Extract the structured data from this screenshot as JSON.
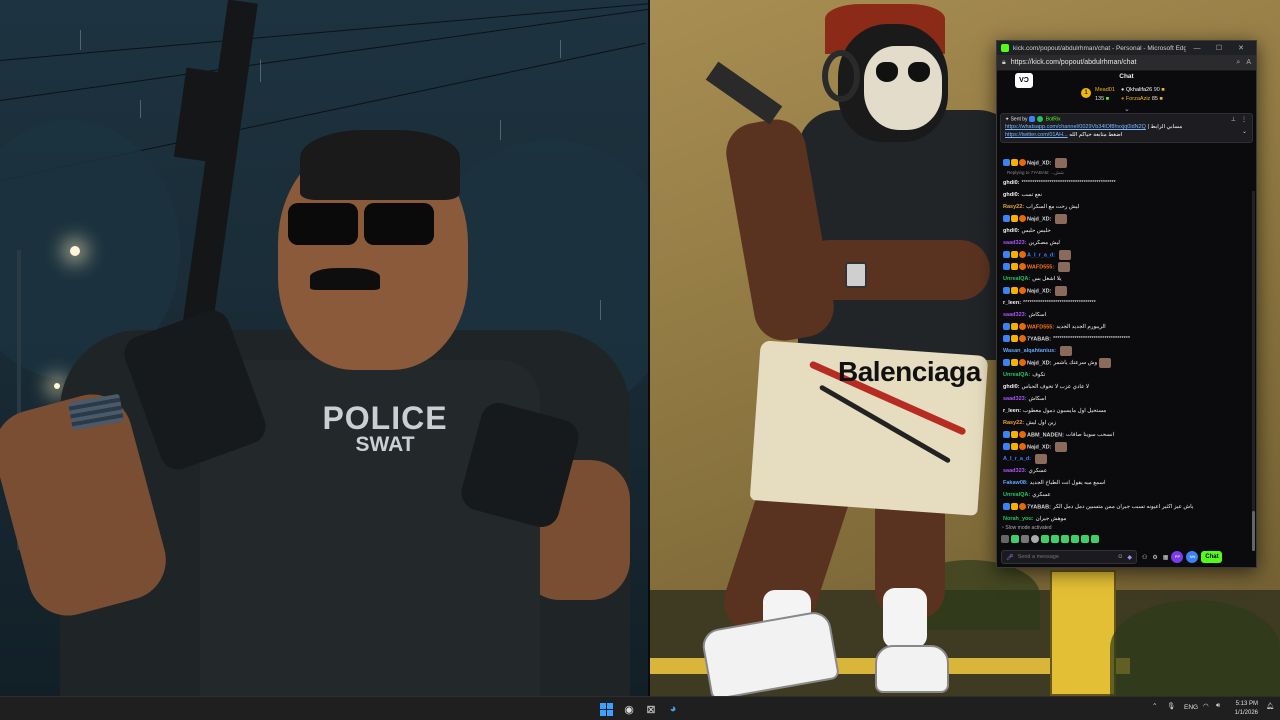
{
  "left_panel": {
    "vest_line1": "POLICE",
    "vest_line2": "SWAT"
  },
  "right_panel": {
    "shorts_text": "Balenciaga"
  },
  "browser": {
    "title": "kick.com/popout/abdulrhman/chat - Personal - Microsoft Edge",
    "url": "https://kick.com/popout/abdulrhman/chat",
    "chat_title": "Chat",
    "channel_badge": "VƆ",
    "leaderboard": {
      "rank": "1",
      "first": {
        "name": "Mead01",
        "value": "135"
      },
      "second": {
        "name": "Qkhalifa26",
        "value": "90"
      },
      "third": {
        "name": "ForzaAziz",
        "value": "85"
      }
    },
    "pinned": {
      "sent_by_label": "Sent by",
      "bot_name": "BotRix",
      "text_prefix": "| مسابي الرابط",
      "link1": "https://whatsapp.com/channel/0029Vb34lOf8hvxjq0ldN2Q",
      "link2": "https://twitter.com/01AH...",
      "text_suffix": "اضغط متابعة حياكم الله"
    },
    "messages": [
      {
        "user": "Najd_XD:",
        "text": "",
        "color": "#d6d6d6",
        "badges": true,
        "emote": true
      },
      {
        "reply": "Replying to 7YABAB: ...شش"
      },
      {
        "user": "ghdi0:",
        "text": "********************************************",
        "color": "#f2f2f2"
      },
      {
        "user": "ghdi0:",
        "text": "نعع تسب",
        "color": "#f2f2f2"
      },
      {
        "user": "Rasy22:",
        "text": "ليش رحت مع السكراب",
        "color": "#e6a23c"
      },
      {
        "user": "Najd_XD:",
        "text": "",
        "color": "#d6d6d6",
        "badges": true,
        "emote": true
      },
      {
        "user": "ghdi0:",
        "text": "حلبس حلبس",
        "color": "#f2f2f2"
      },
      {
        "user": "saad323:",
        "text": "ليش مصكرين",
        "color": "#a855f7"
      },
      {
        "user": "A_I_r_a_d:",
        "text": "",
        "color": "#3b82f6",
        "badges": true,
        "emote": true
      },
      {
        "user": "WAFD555:",
        "text": "",
        "color": "#f97316",
        "badges": true,
        "emote": true
      },
      {
        "user": "UnrealQA:",
        "text": "يلا اشغل بس",
        "color": "#22c55e"
      },
      {
        "user": "Najd_XD:",
        "text": "",
        "color": "#d6d6d6",
        "badges": true,
        "emote": true
      },
      {
        "user": "r_leen:",
        "text": "**********************************",
        "color": "#f2f2f2"
      },
      {
        "user": "saad323:",
        "text": "اسكاش",
        "color": "#a855f7"
      },
      {
        "user": "WAFD555:",
        "text": "الريبورم الجديد الجديد",
        "color": "#f97316",
        "badges": true
      },
      {
        "user": "7YABAB:",
        "text": "************************************",
        "color": "#d6d6d6",
        "badges": true
      },
      {
        "user": "Wasan_alqahtanius:",
        "text": "",
        "color": "#60a5fa",
        "emote": true
      },
      {
        "user": "Najd_XD:",
        "text": "وش سرعتك ياشمر",
        "color": "#d6d6d6",
        "badges": true,
        "emote": true
      },
      {
        "user": "UnrealQA:",
        "text": "تكوف",
        "color": "#22c55e"
      },
      {
        "user": "ghdi0:",
        "text": "لا عادي عزب لا تخوف الحباس",
        "color": "#f2f2f2"
      },
      {
        "user": "saad323:",
        "text": "اسكاش",
        "color": "#a855f7"
      },
      {
        "user": "r_leen:",
        "text": "مستحيل اول مايسبون دمول معطوب",
        "color": "#f2f2f2"
      },
      {
        "user": "Rasy22:",
        "text": "زين اول ليش",
        "color": "#e6a23c"
      },
      {
        "user": "ABM_NADEN:",
        "text": "انسحب سوينا صافات",
        "color": "#d6d6d6",
        "badges": true
      },
      {
        "user": "Najd_XD:",
        "text": "",
        "color": "#d6d6d6",
        "badges": true,
        "emote": true
      },
      {
        "user": "A_I_r_a_d:",
        "text": "",
        "color": "#3b82f6",
        "emote": true
      },
      {
        "user": "saad323:",
        "text": "عسكري",
        "color": "#a855f7"
      },
      {
        "user": "Fakaw08:",
        "text": "اسمع ميه يقول انت الطباخ الجديد",
        "color": "#60a5fa"
      },
      {
        "user": "UnrealQA:",
        "text": "عسكري",
        "color": "#22c55e"
      },
      {
        "user": "7YABAB:",
        "text": "ياش عيز اكثير اعيونه تسبب جيران ممن متسبين دمل دمل الكر",
        "color": "#d6d6d6",
        "badges": true
      },
      {
        "user": "Norah_you:",
        "text": "موهش جيران",
        "color": "#22c55e"
      }
    ],
    "slow_mode": "Slow mode activated",
    "input_placeholder": "Send a message",
    "chat_button": "Chat",
    "chip1": "PP",
    "chip2": "NN"
  },
  "taskbar": {
    "lang": "ENG",
    "time": "5:13 PM",
    "date": "1/1/2026"
  }
}
